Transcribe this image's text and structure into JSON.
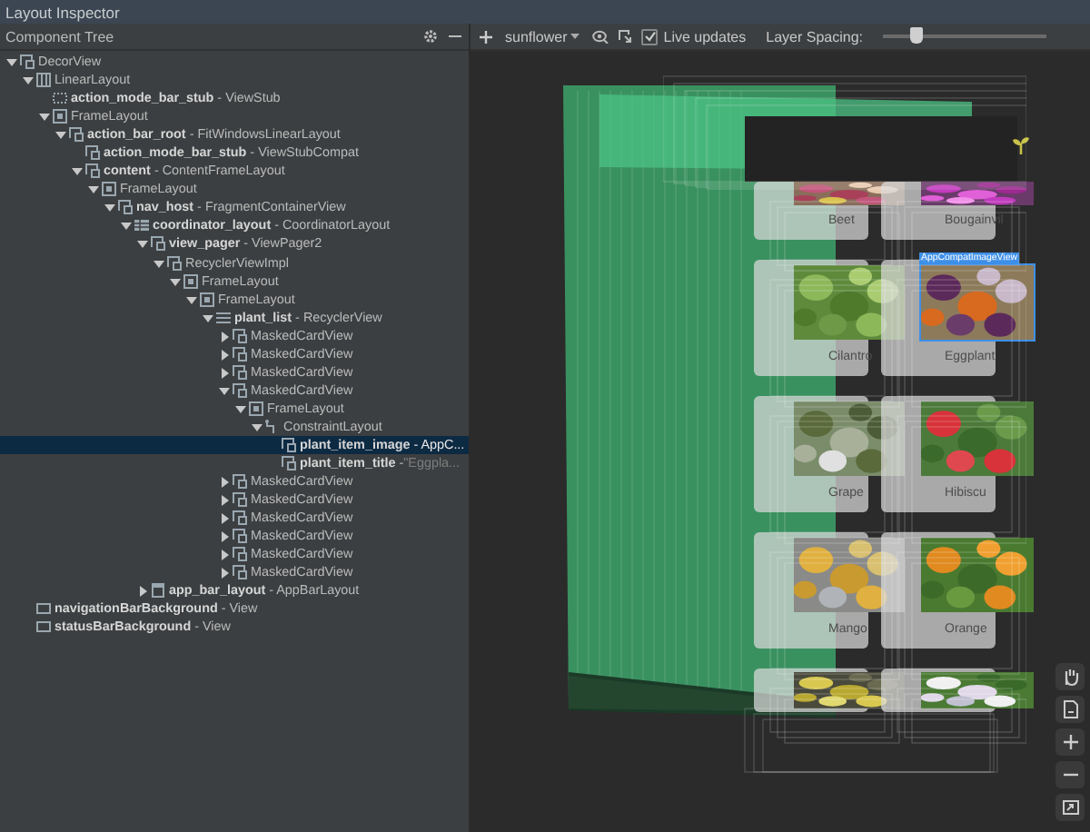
{
  "window": {
    "title": "Layout Inspector"
  },
  "tree_panel": {
    "title": "Component Tree"
  },
  "toolbar": {
    "process": "sunflower",
    "live_updates": {
      "label": "Live updates",
      "checked": true
    },
    "layer_spacing": {
      "label": "Layer Spacing:",
      "level": 0.2
    }
  },
  "tree": [
    {
      "label": "DecorView",
      "kind": "view",
      "expanded": true,
      "selected": false,
      "children": [
        {
          "label": "LinearLayout",
          "kind": "linear",
          "expanded": true,
          "selected": false,
          "children": [
            {
              "label": "**action_mode_bar_stub** - ViewStub",
              "kind": "stub",
              "selected": false
            },
            {
              "label": "FrameLayout",
              "kind": "frame",
              "expanded": true,
              "selected": false,
              "children": [
                {
                  "label": "**action_bar_root** - FitWindowsLinearLayout",
                  "kind": "view",
                  "expanded": true,
                  "selected": false,
                  "children": [
                    {
                      "label": "**action_mode_bar_stub** - ViewStubCompat",
                      "kind": "view",
                      "selected": false
                    },
                    {
                      "label": "**content** - ContentFrameLayout",
                      "kind": "view",
                      "expanded": true,
                      "selected": false,
                      "children": [
                        {
                          "label": "FrameLayout",
                          "kind": "frame",
                          "expanded": true,
                          "selected": false,
                          "children": [
                            {
                              "label": "**nav_host** - FragmentContainerView",
                              "kind": "view",
                              "expanded": true,
                              "selected": false,
                              "children": [
                                {
                                  "label": "**coordinator_layout** - CoordinatorLayout",
                                  "kind": "coordinator",
                                  "expanded": true,
                                  "selected": false,
                                  "children": [
                                    {
                                      "label": "**view_pager** - ViewPager2",
                                      "kind": "view",
                                      "expanded": true,
                                      "selected": false,
                                      "children": [
                                        {
                                          "label": "RecyclerViewImpl",
                                          "kind": "view",
                                          "expanded": true,
                                          "selected": false,
                                          "children": [
                                            {
                                              "label": "FrameLayout",
                                              "kind": "frame",
                                              "expanded": true,
                                              "selected": false,
                                              "children": [
                                                {
                                                  "label": "FrameLayout",
                                                  "kind": "frame",
                                                  "expanded": true,
                                                  "selected": false,
                                                  "children": [
                                                    {
                                                      "label": "**plant_list** - RecyclerView",
                                                      "kind": "list",
                                                      "expanded": true,
                                                      "selected": false,
                                                      "children": [
                                                        {
                                                          "label": "MaskedCardView",
                                                          "kind": "view",
                                                          "expanded": false,
                                                          "selected": false
                                                        },
                                                        {
                                                          "label": "MaskedCardView",
                                                          "kind": "view",
                                                          "expanded": false,
                                                          "selected": false
                                                        },
                                                        {
                                                          "label": "MaskedCardView",
                                                          "kind": "view",
                                                          "expanded": false,
                                                          "selected": false
                                                        },
                                                        {
                                                          "label": "MaskedCardView",
                                                          "kind": "view",
                                                          "expanded": true,
                                                          "selected": false,
                                                          "children": [
                                                            {
                                                              "label": "FrameLayout",
                                                              "kind": "frame",
                                                              "expanded": true,
                                                              "selected": false,
                                                              "children": [
                                                                {
                                                                  "label": "ConstraintLayout",
                                                                  "kind": "constraint",
                                                                  "expanded": true,
                                                                  "selected": false,
                                                                  "children": [
                                                                    {
                                                                      "label": "**plant_item_image** - AppC...",
                                                                      "kind": "view",
                                                                      "selected": true
                                                                    },
                                                                    {
                                                                      "label": "**plant_item_title** -",
                                                                      "value": "\"Eggpla...",
                                                                      "kind": "view",
                                                                      "selected": false
                                                                    }
                                                                  ]
                                                                }
                                                              ]
                                                            }
                                                          ]
                                                        },
                                                        {
                                                          "label": "MaskedCardView",
                                                          "kind": "view",
                                                          "expanded": false,
                                                          "selected": false
                                                        },
                                                        {
                                                          "label": "MaskedCardView",
                                                          "kind": "view",
                                                          "expanded": false,
                                                          "selected": false
                                                        },
                                                        {
                                                          "label": "MaskedCardView",
                                                          "kind": "view",
                                                          "expanded": false,
                                                          "selected": false
                                                        },
                                                        {
                                                          "label": "MaskedCardView",
                                                          "kind": "view",
                                                          "expanded": false,
                                                          "selected": false
                                                        },
                                                        {
                                                          "label": "MaskedCardView",
                                                          "kind": "view",
                                                          "expanded": false,
                                                          "selected": false
                                                        },
                                                        {
                                                          "label": "MaskedCardView",
                                                          "kind": "view",
                                                          "expanded": false,
                                                          "selected": false
                                                        }
                                                      ]
                                                    }
                                                  ]
                                                }
                                              ]
                                            }
                                          ]
                                        }
                                      ]
                                    },
                                    {
                                      "label": "**app_bar_layout** - AppBarLayout",
                                      "kind": "appbar",
                                      "expanded": false,
                                      "selected": false
                                    }
                                  ]
                                }
                              ]
                            }
                          ]
                        }
                      ]
                    }
                  ]
                }
              ]
            }
          ]
        },
        {
          "label": "**navigationBarBackground** - View",
          "kind": "plain",
          "selected": false
        },
        {
          "label": "**statusBarBackground** - View",
          "kind": "plain",
          "selected": false
        }
      ]
    }
  ],
  "canvas": {
    "selection_tag": "AppCompatImageView",
    "cards": [
      {
        "label": "Beet",
        "selected": false
      },
      {
        "label": "Bougainvil",
        "selected": false
      },
      {
        "label": "Cilantro",
        "selected": false
      },
      {
        "label": "Eggplant",
        "selected": true
      },
      {
        "label": "Grape",
        "selected": false
      },
      {
        "label": "Hibiscu",
        "selected": false
      },
      {
        "label": "Mango",
        "selected": false
      },
      {
        "label": "Orange",
        "selected": false
      },
      {
        "selected": false
      },
      {
        "selected": false
      }
    ]
  }
}
